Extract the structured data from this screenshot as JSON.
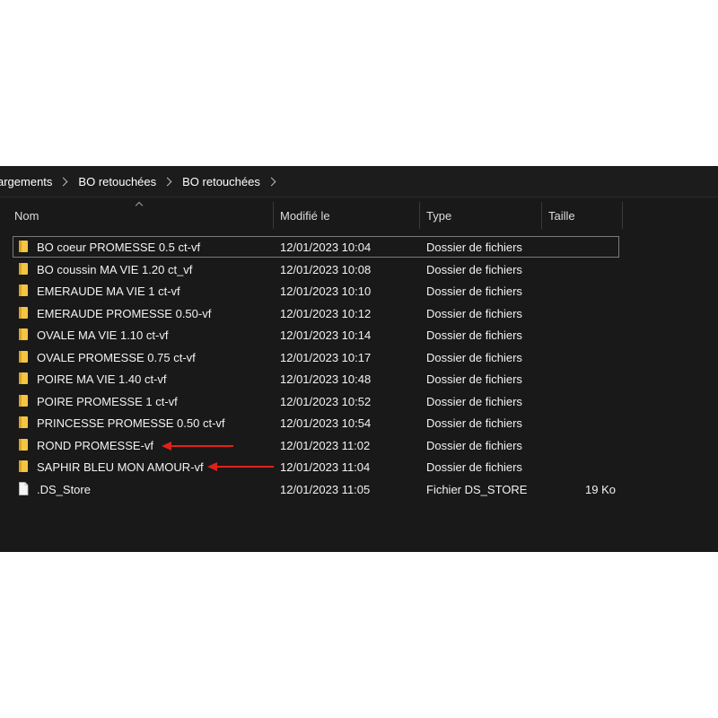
{
  "breadcrumb": [
    "argements",
    "BO retouchées",
    "BO retouchées"
  ],
  "columns": {
    "name": "Nom",
    "modified": "Modifié le",
    "type": "Type",
    "size": "Taille"
  },
  "colors": {
    "background": "#191919",
    "folder": "#f4c542",
    "arrow": "#e0211b"
  },
  "files": [
    {
      "name": "BO coeur PROMESSE 0.5 ct-vf",
      "modified": "12/01/2023 10:04",
      "type": "Dossier de fichiers",
      "size": "",
      "icon": "folder-icon"
    },
    {
      "name": "BO coussin MA VIE 1.20 ct_vf",
      "modified": "12/01/2023 10:08",
      "type": "Dossier de fichiers",
      "size": "",
      "icon": "folder-icon"
    },
    {
      "name": "EMERAUDE MA VIE 1 ct-vf",
      "modified": "12/01/2023 10:10",
      "type": "Dossier de fichiers",
      "size": "",
      "icon": "folder-icon"
    },
    {
      "name": "EMERAUDE PROMESSE 0.50-vf",
      "modified": "12/01/2023 10:12",
      "type": "Dossier de fichiers",
      "size": "",
      "icon": "folder-icon"
    },
    {
      "name": "OVALE MA VIE 1.10 ct-vf",
      "modified": "12/01/2023 10:14",
      "type": "Dossier de fichiers",
      "size": "",
      "icon": "folder-icon"
    },
    {
      "name": "OVALE PROMESSE 0.75 ct-vf",
      "modified": "12/01/2023 10:17",
      "type": "Dossier de fichiers",
      "size": "",
      "icon": "folder-icon"
    },
    {
      "name": "POIRE MA VIE 1.40 ct-vf",
      "modified": "12/01/2023 10:48",
      "type": "Dossier de fichiers",
      "size": "",
      "icon": "folder-icon"
    },
    {
      "name": "POIRE PROMESSE 1 ct-vf",
      "modified": "12/01/2023 10:52",
      "type": "Dossier de fichiers",
      "size": "",
      "icon": "folder-icon"
    },
    {
      "name": "PRINCESSE PROMESSE 0.50 ct-vf",
      "modified": "12/01/2023 10:54",
      "type": "Dossier de fichiers",
      "size": "",
      "icon": "folder-icon"
    },
    {
      "name": "ROND PROMESSE-vf",
      "modified": "12/01/2023 11:02",
      "type": "Dossier de fichiers",
      "size": "",
      "icon": "folder-icon"
    },
    {
      "name": "SAPHIR BLEU MON AMOUR-vf",
      "modified": "12/01/2023 11:04",
      "type": "Dossier de fichiers",
      "size": "",
      "icon": "folder-icon"
    },
    {
      "name": ".DS_Store",
      "modified": "12/01/2023 11:05",
      "type": "Fichier DS_STORE",
      "size": "19 Ko",
      "icon": "file-icon"
    }
  ]
}
